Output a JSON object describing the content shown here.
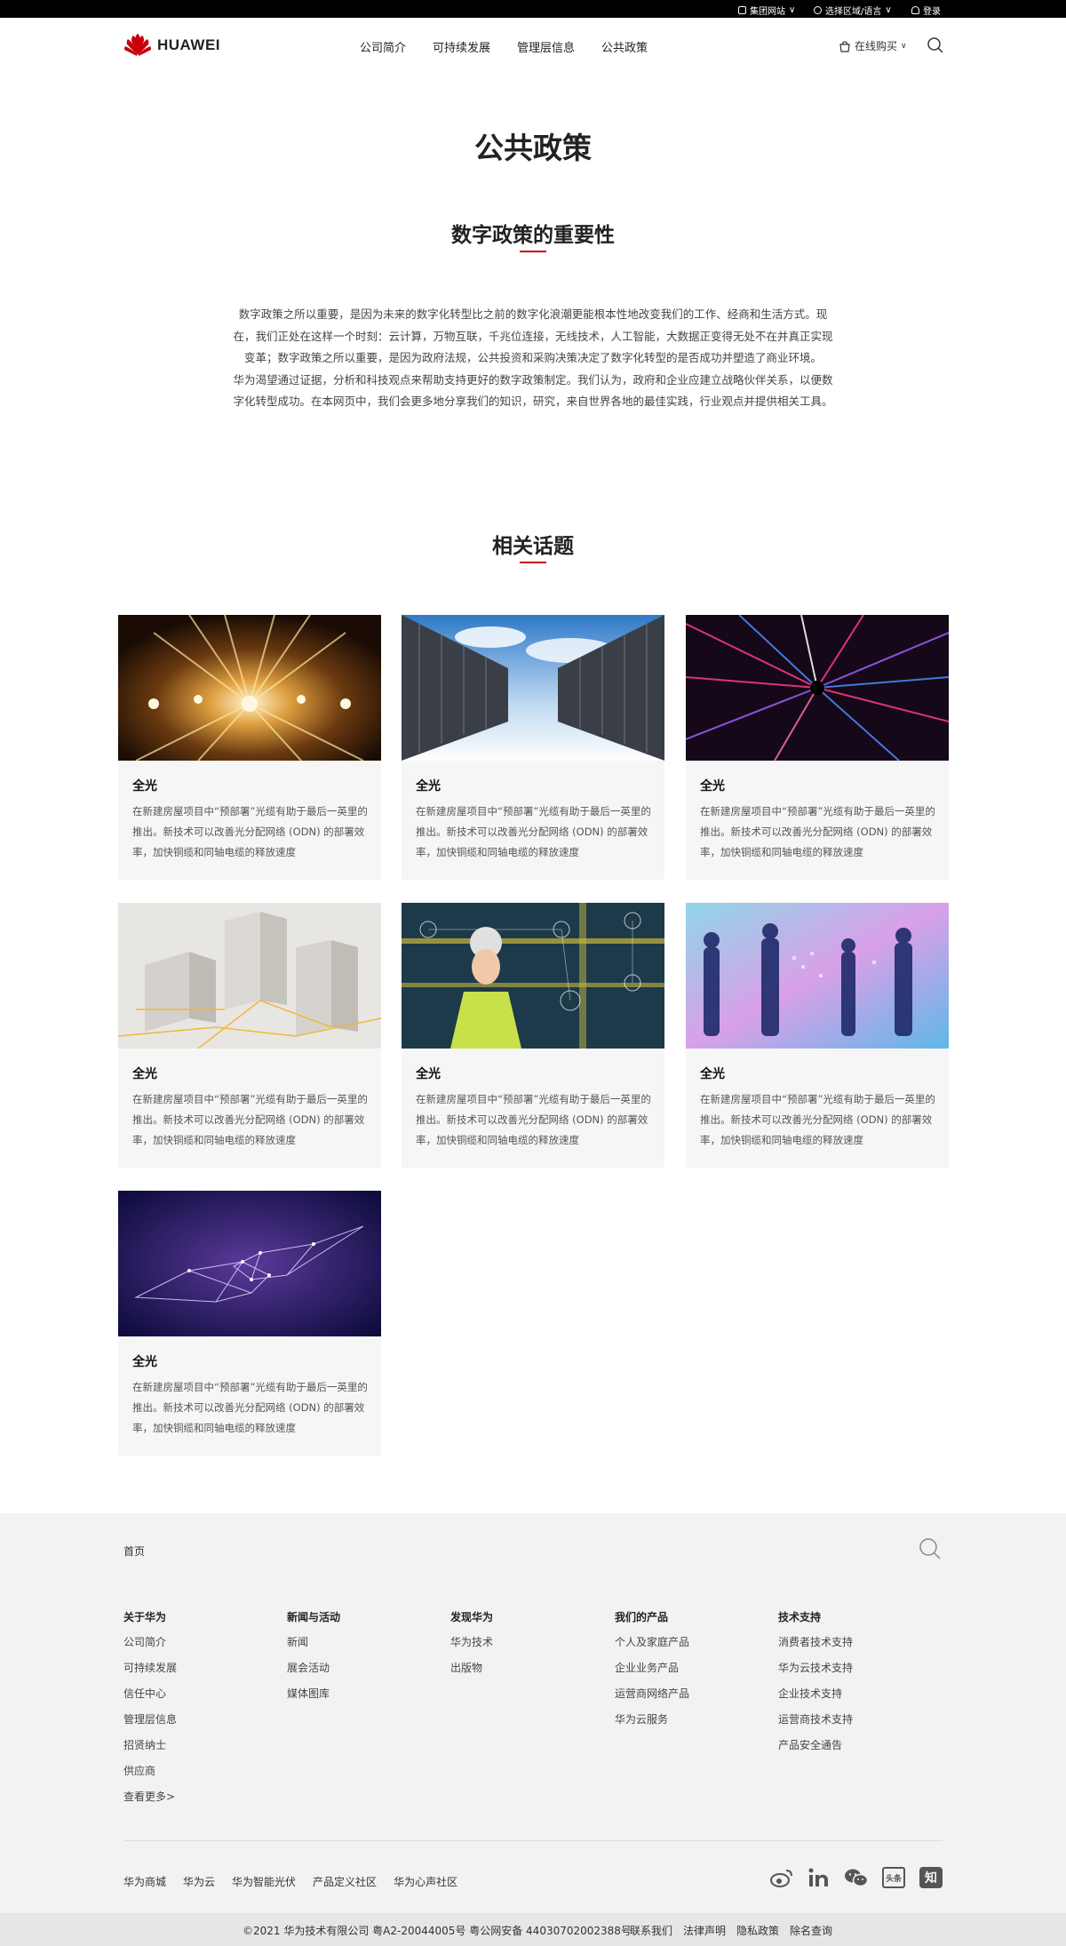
{
  "topbar": {
    "group_sites": "集团网站",
    "region_language": "选择区域/语言",
    "login": "登录"
  },
  "header": {
    "logo_text": "HUAWEI",
    "nav": [
      "公司简介",
      "可持续发展",
      "管理层信息",
      "公共政策"
    ],
    "shop_label": "在线购买"
  },
  "page": {
    "title": "公共政策",
    "section1_title": "数字政策的重要性",
    "intro_p1": "数字政策之所以重要，是因为未来的数字化转型比之前的数字化浪潮更能根本性地改变我们的工作、经商和生活方式。现在，我们正处在这样一个时刻：云计算，万物互联，千兆位连接，无线技术，人工智能，大数据正变得无处不在并真正实现变革；数字政策之所以重要，是因为政府法规，公共投资和采购决策决定了数字化转型的是否成功并塑造了商业环境。",
    "intro_p2": "华为渴望通过证据，分析和科技观点来帮助支持更好的数字政策制定。我们认为，政府和企业应建立战略伙伴关系，以便数字化转型成功。在本网页中，我们会更多地分享我们的知识，研究，来自世界各地的最佳实践，行业观点并提供相关工具。",
    "section2_title": "相关话题"
  },
  "cards": [
    {
      "title": "全光",
      "desc": "在新建房屋项目中“预部署”光缆有助于最后一英里的推出。新技术可以改善光分配网络 (ODN) 的部署效率，加快铜缆和同轴电缆的释放速度",
      "image": "golden-light-tunnel"
    },
    {
      "title": "全光",
      "desc": "在新建房屋项目中“预部署”光缆有助于最后一英里的推出。新技术可以改善光分配网络 (ODN) 的部署效率，加快铜缆和同轴电缆的释放速度",
      "image": "server-racks-sky"
    },
    {
      "title": "全光",
      "desc": "在新建房屋项目中“预部署”光缆有助于最后一英里的推出。新技术可以改善光分配网络 (ODN) 的部署效率，加快铜缆和同轴电缆的释放速度",
      "image": "fiber-light-burst"
    },
    {
      "title": "全光",
      "desc": "在新建房屋项目中“预部署”光缆有助于最后一英里的推出。新技术可以改善光分配网络 (ODN) 的部署效率，加快铜缆和同轴电缆的释放速度",
      "image": "city-model"
    },
    {
      "title": "全光",
      "desc": "在新建房屋项目中“预部署”光缆有助于最后一英里的推出。新技术可以改善光分配网络 (ODN) 的部署效率，加快铜缆和同轴电缆的释放速度",
      "image": "engineer-network"
    },
    {
      "title": "全光",
      "desc": "在新建房屋项目中“预部署”光缆有助于最后一英里的推出。新技术可以改善光分配网络 (ODN) 的部署效率，加快铜缆和同轴电缆的释放速度",
      "image": "business-people-silhouettes"
    },
    {
      "title": "全光",
      "desc": "在新建房屋项目中“预部署”光缆有助于最后一英里的推出。新技术可以改善光分配网络 (ODN) 的部署效率，加快铜缆和同轴电缆的释放速度",
      "image": "digital-handshake"
    }
  ],
  "footer": {
    "home": "首页",
    "columns": [
      {
        "title": "关于华为",
        "links": [
          "公司简介",
          "可持续发展",
          "信任中心",
          "管理层信息",
          "招贤纳士",
          "供应商",
          "查看更多>"
        ]
      },
      {
        "title": "新闻与活动",
        "links": [
          "新闻",
          "展会活动",
          "媒体图库"
        ]
      },
      {
        "title": "发现华为",
        "links": [
          "华为技术",
          "出版物"
        ]
      },
      {
        "title": "我们的产品",
        "links": [
          "个人及家庭产品",
          "企业业务产品",
          "运营商网络产品",
          "华为云服务"
        ]
      },
      {
        "title": "技术支持",
        "links": [
          "消费者技术支持",
          "华为云技术支持",
          "企业技术支持",
          "运营商技术支持",
          "产品安全通告"
        ]
      }
    ],
    "bottom_links": [
      "华为商城",
      "华为云",
      "华为智能光伏",
      "产品定义社区",
      "华为心声社区"
    ],
    "social_icons": [
      "weibo-icon",
      "linkedin-icon",
      "wechat-icon",
      "toutiao-icon",
      "zhihu-icon"
    ],
    "toutiao_label": "头条",
    "zhihu_label": "知"
  },
  "copyright": {
    "text": "©2021 华为技术有限公司 粤A2-20044005号 粤公网安备 44030702002388号",
    "links": [
      "联系我们",
      "法律声明",
      "隐私政策",
      "除名查询"
    ]
  },
  "colors": {
    "brand_red": "#c7000b",
    "topbar_bg": "#000000",
    "footer_bg": "#f2f2f2",
    "card_bg": "#f6f6f6"
  }
}
